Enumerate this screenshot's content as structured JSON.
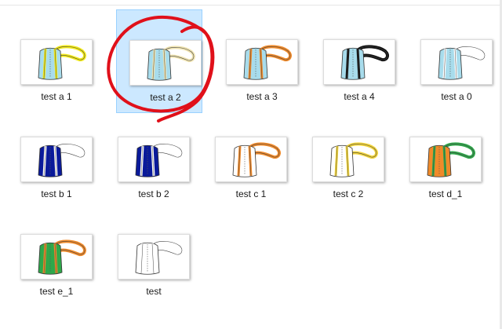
{
  "files": [
    {
      "name": "test a 1",
      "selected": false,
      "body": "#a8dcec",
      "strap": "#f2ea1a"
    },
    {
      "name": "test a 2",
      "selected": true,
      "body": "#a8dcec",
      "strap": "#efe3b0"
    },
    {
      "name": "test a 3",
      "selected": false,
      "body": "#a8dcec",
      "strap": "#f08a2a"
    },
    {
      "name": "test a 4",
      "selected": false,
      "body": "#a8dcec",
      "strap": "#111111"
    },
    {
      "name": "test a 0",
      "selected": false,
      "body": "#a8dcec",
      "strap": "#ffffff"
    },
    {
      "name": "test b 1",
      "selected": false,
      "body": "#0a1a9a",
      "strap": "#ffffff"
    },
    {
      "name": "test b 2",
      "selected": false,
      "body": "#0a1a9a",
      "strap": "#ffffff"
    },
    {
      "name": "test c 1",
      "selected": false,
      "body": "#ffffff",
      "strap": "#f08a2a"
    },
    {
      "name": "test c 2",
      "selected": false,
      "body": "#ffffff",
      "strap": "#f2d43a"
    },
    {
      "name": "test d_1",
      "selected": false,
      "body": "#f08a2a",
      "strap": "#2ea84a"
    },
    {
      "name": "test e_1",
      "selected": false,
      "body": "#2ea84a",
      "strap": "#f08a2a"
    },
    {
      "name": "test",
      "selected": false,
      "body": "#ffffff",
      "strap": "#ffffff"
    }
  ],
  "annotation": {
    "color": "#e0101a",
    "shape": "hand-drawn circle around selected file"
  }
}
